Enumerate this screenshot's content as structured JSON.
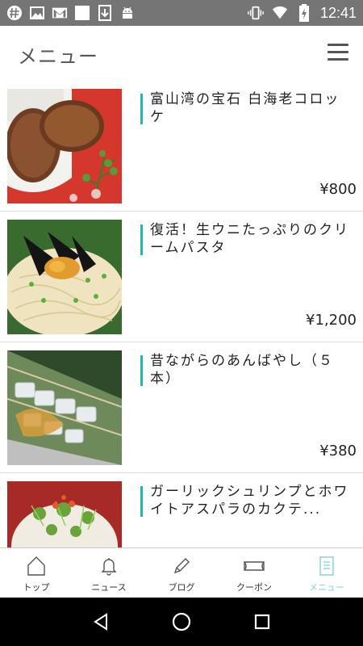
{
  "status_bar": {
    "time": "12:41",
    "icons_left": [
      "hashtag-icon",
      "image-icon",
      "gmail-icon",
      "blank-square-icon",
      "download-icon",
      "android-icon"
    ],
    "icons_right": [
      "vibrate-icon",
      "wifi-icon",
      "battery-charging-icon"
    ]
  },
  "header": {
    "title": "メニュー",
    "menu_icon": "hamburger-icon"
  },
  "menu_items": [
    {
      "name": "富山湾の宝石 白海老コロッケ",
      "price": "¥800",
      "image": "croquette-photo"
    },
    {
      "name": "復活！生ウニたっぷりのクリームパスタ",
      "price": "¥1,200",
      "image": "uni-pasta-photo"
    },
    {
      "name": "昔ながらのあんばやし（５本）",
      "price": "¥380",
      "image": "anbayashi-photo"
    },
    {
      "name": "ガーリックシュリンプとホワイトアスパラのカクテ...",
      "price": "",
      "image": "shrimp-salad-photo"
    }
  ],
  "tabs": [
    {
      "label": "トップ",
      "icon": "home-icon"
    },
    {
      "label": "ニュース",
      "icon": "bell-icon"
    },
    {
      "label": "ブログ",
      "icon": "pencil-icon"
    },
    {
      "label": "クーポン",
      "icon": "ticket-icon"
    },
    {
      "label": "メニュー",
      "icon": "document-icon",
      "active": true
    }
  ],
  "colors": {
    "accent": "#27b3b0",
    "active_tab": "#7fd3d1",
    "status_bar": "#757575"
  }
}
